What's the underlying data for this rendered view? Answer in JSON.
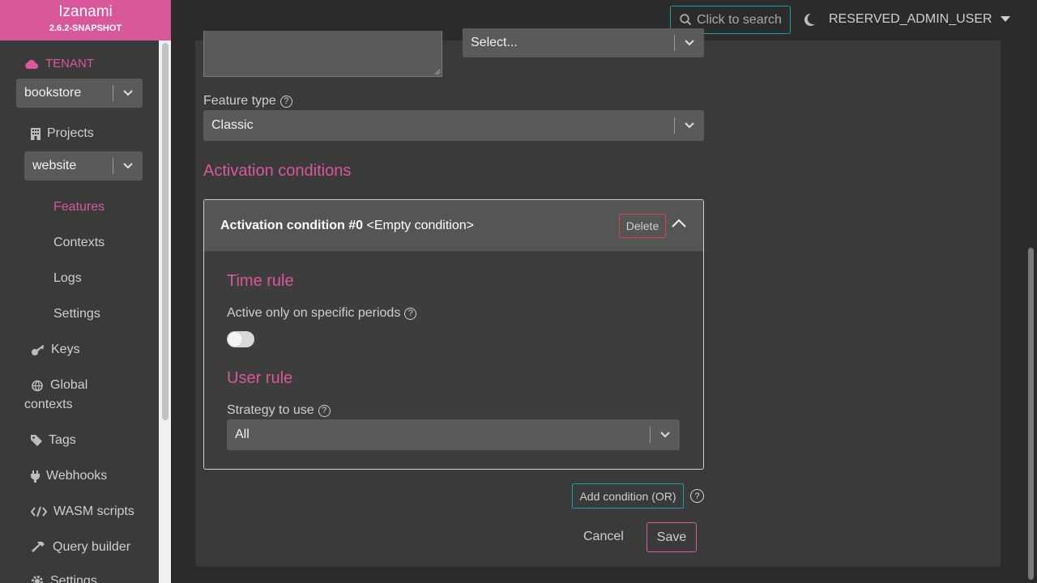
{
  "brand": {
    "name": "Izanami",
    "version": "2.6.2-SNAPSHOT"
  },
  "header": {
    "search_label": "Click to search",
    "user": "RESERVED_ADMIN_USER"
  },
  "sidebar": {
    "tenant_label": "TENANT",
    "tenant_value": "bookstore",
    "projects_label": "Projects",
    "project_value": "website",
    "project_items": [
      "Features",
      "Contexts",
      "Logs",
      "Settings"
    ],
    "keys": "Keys",
    "global_contexts_1": "Global",
    "global_contexts_2": "contexts",
    "tags": "Tags",
    "webhooks": "Webhooks",
    "wasm": "WASM scripts",
    "query_builder": "Query builder",
    "settings": "Settings"
  },
  "form": {
    "top_select_value": "Select...",
    "feature_type_label": "Feature type",
    "feature_type_value": "Classic",
    "activation_title": "Activation conditions",
    "condition": {
      "title_bold": "Activation condition #0",
      "title_rest": "<Empty condition>",
      "delete_label": "Delete",
      "time_rule_title": "Time rule",
      "active_periods_label": "Active only on specific periods",
      "active_periods_enabled": false,
      "user_rule_title": "User rule",
      "strategy_label": "Strategy to use",
      "strategy_value": "All"
    },
    "add_condition_label": "Add condition (OR)",
    "cancel_label": "Cancel",
    "save_label": "Save"
  },
  "colors": {
    "accent": "#d9579b",
    "teal": "#1a9fa8",
    "danger": "#d9434b"
  }
}
